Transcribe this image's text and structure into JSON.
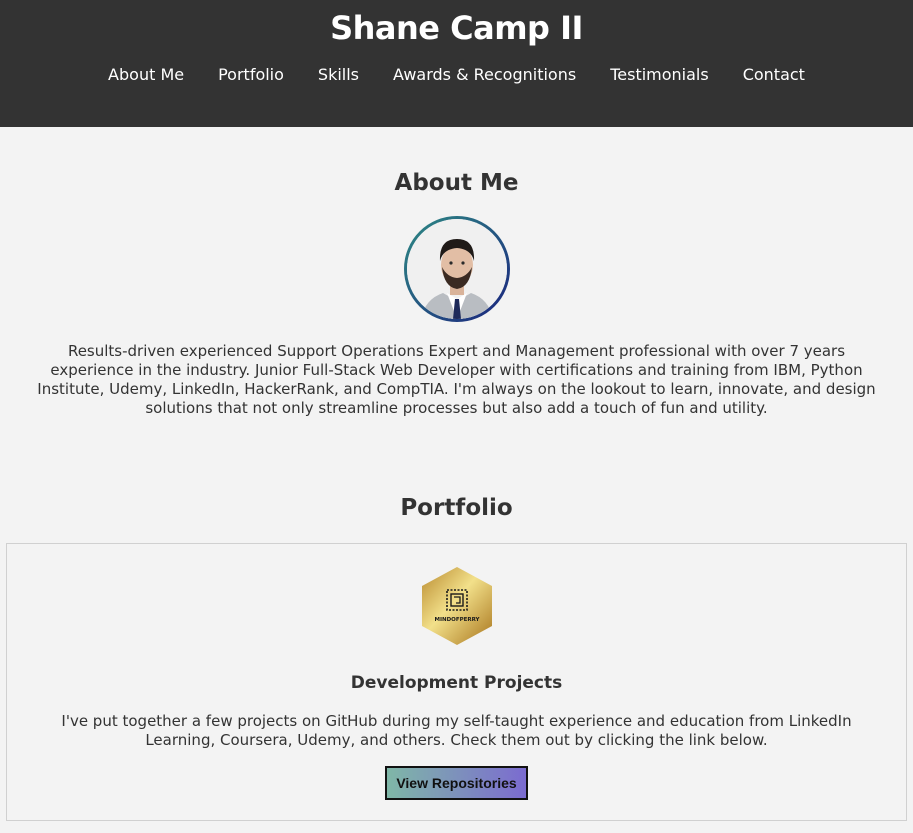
{
  "header": {
    "title": "Shane Camp II",
    "nav": [
      "About Me",
      "Portfolio",
      "Skills",
      "Awards & Recognitions",
      "Testimonials",
      "Contact"
    ]
  },
  "about": {
    "heading": "About Me",
    "text": "Results-driven experienced Support Operations Expert and Management professional with over 7 years experience in the industry. Junior Full-Stack Web Developer with certifications and training from IBM, Python Institute, Udemy, LinkedIn, HackerRank, and CompTIA. I'm always on the lookout to learn, innovate, and design solutions that not only streamline processes but also add a touch of fun and utility."
  },
  "portfolio": {
    "heading": "Portfolio",
    "logo_text": "MINDOFPERRY",
    "card_title": "Development Projects",
    "card_text": "I've put together a few projects on GitHub during my self-taught experience and education from LinkedIn Learning, Coursera, Udemy, and others. Check them out by clicking the link below.",
    "button_label": "View Repositories"
  },
  "colors": {
    "header_bg": "#333333",
    "page_bg": "#f3f3f3",
    "button_gradient": [
      "#7fb7a7",
      "#7b6bd0"
    ],
    "avatar_ring": [
      "#2e8b84",
      "#1a237e"
    ]
  }
}
